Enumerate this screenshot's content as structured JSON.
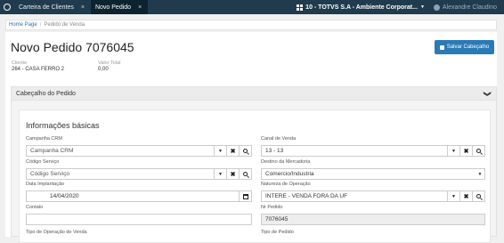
{
  "topbar": {
    "tabs": [
      {
        "label": "Carteira de Clientes",
        "close": "×"
      },
      {
        "label": "Novo Pedido",
        "close": "×"
      }
    ],
    "company": "10 - TOTVS S.A - Ambiente Corporat...",
    "user": "Alexandre Claudino"
  },
  "breadcrumb": {
    "home": "Home Page",
    "separator": "/",
    "current": "Pedido de Venda"
  },
  "page": {
    "title": "Novo Pedido 7076045",
    "save_label": "Salvar Cabeçalho",
    "cliente_label": "Cliente",
    "cliente_value": "264 - CASA FERRO 2",
    "valor_label": "Valor Total",
    "valor_value": "0,00"
  },
  "section": {
    "title": "Cabeçalho do Pedido",
    "group_title": "Informações básicas",
    "fields": {
      "campanha": {
        "label": "Campanha CRM",
        "value": "Campanha CRM"
      },
      "codigo": {
        "label": "Código Serviço",
        "value": "Código Serviço"
      },
      "data": {
        "label": "Data Implantação",
        "value": "14/04/2020"
      },
      "contato": {
        "label": "Contato",
        "value": ""
      },
      "tipo_operacao": {
        "label": "Tipo de Operação de Venda"
      },
      "canal": {
        "label": "Canal de Venda",
        "value": "13 - 13"
      },
      "destino": {
        "label": "Destino da Mercadoria",
        "value": "Comercio/Industria"
      },
      "natureza": {
        "label": "Natureza de Operação",
        "value": "INTERE - VENDA FORA DA UF"
      },
      "nr_pedido": {
        "label": "Nr Pedido",
        "value": "7076045"
      },
      "tipo_pedido": {
        "label": "Tipo de Pedido"
      }
    }
  },
  "icons": {
    "close": "×",
    "dropdown": "▼",
    "clear": "✖",
    "chevron": "❯"
  }
}
